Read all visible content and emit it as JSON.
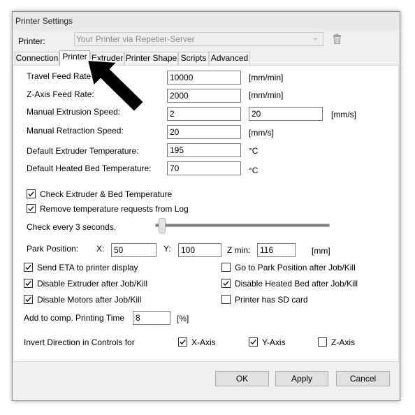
{
  "window": {
    "title": "Printer Settings"
  },
  "printer_row": {
    "label": "Printer:",
    "selected": "Your Printer via Repetier-Server"
  },
  "tabs": [
    {
      "label": "Connection"
    },
    {
      "label": "Printer"
    },
    {
      "label": "Extruder"
    },
    {
      "label": "Printer Shape"
    },
    {
      "label": "Scripts"
    },
    {
      "label": "Advanced"
    }
  ],
  "settings": {
    "travel_feed": {
      "label": "Travel Feed Rate:",
      "value": "10000",
      "unit": "[mm/min]"
    },
    "z_feed": {
      "label": "Z-Axis Feed Rate:",
      "value": "2000",
      "unit": "[mm/min]"
    },
    "manual_extrusion": {
      "label": "Manual Extrusion Speed:",
      "value1": "2",
      "value2": "20",
      "unit": "[mm/s]"
    },
    "manual_retraction": {
      "label": "Manual Retraction Speed:",
      "value": "20",
      "unit": "[mm/s]"
    },
    "extruder_temp": {
      "label": "Default Extruder Temperature:",
      "value": "195",
      "unit": "°C"
    },
    "bed_temp": {
      "label": "Default Heated Bed Temperature:",
      "value": "70",
      "unit": "°C"
    }
  },
  "checks": {
    "check_temp": {
      "label": "Check Extruder & Bed Temperature",
      "checked": true
    },
    "remove_temp": {
      "label": "Remove temperature requests from Log",
      "checked": true
    },
    "send_eta": {
      "label": "Send ETA to printer display",
      "checked": true
    },
    "goto_park": {
      "label": "Go to Park Position after Job/Kill",
      "checked": false
    },
    "disable_extruder": {
      "label": "Disable Extruder after Job/Kill",
      "checked": true
    },
    "disable_bed": {
      "label": "Disable Heated Bed after Job/Kill",
      "checked": true
    },
    "disable_motors": {
      "label": "Disable Motors after Job/Kill",
      "checked": true
    },
    "sd_card": {
      "label": "Printer has SD card",
      "checked": false
    }
  },
  "check_every": {
    "label": "Check every 3 seconds.",
    "slider_fraction": 0.0
  },
  "park": {
    "label": "Park Position:",
    "x_label": "X:",
    "x_value": "50",
    "y_label": "Y:",
    "y_value": "100",
    "z_label": "Z min:",
    "z_value": "116",
    "unit": "[mm]"
  },
  "comp_time": {
    "label": "Add to comp. Printing Time",
    "value": "8",
    "unit": "[%]"
  },
  "invert": {
    "label": "Invert Direction in Controls for",
    "x": {
      "label": "X-Axis",
      "checked": true
    },
    "y": {
      "label": "Y-Axis",
      "checked": true
    },
    "z": {
      "label": "Z-Axis",
      "checked": false
    }
  },
  "buttons": {
    "ok": "OK",
    "apply": "Apply",
    "cancel": "Cancel"
  },
  "colors": {
    "window_bg": "#f0f0f0",
    "panel_bg": "#ffffff",
    "arrow": "#000000"
  }
}
